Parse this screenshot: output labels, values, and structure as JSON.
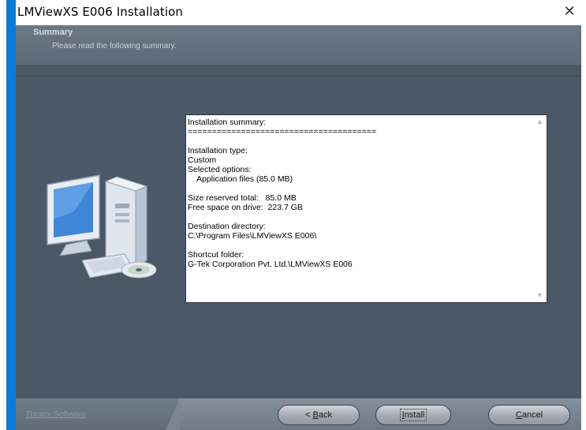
{
  "window": {
    "title": "LMViewXS E006 Installation",
    "close_glyph": "✕"
  },
  "header": {
    "heading": "Summary",
    "subheading": "Please read the following summary."
  },
  "summary": {
    "lines": [
      "Installation summary:",
      "=======================================",
      "",
      "Installation type:",
      "Custom",
      "Selected options:",
      "    Application files (85.0 MB)",
      "",
      "Size reserved total:   85.0 MB",
      "Free space on drive:  223.7 GB",
      "",
      "Destination directory:",
      "C:\\Program Files\\LMViewXS E006\\",
      "",
      "Shortcut folder:",
      "G-Tek Corporation Pvt. Ltd.\\LMViewXS E006"
    ]
  },
  "footer": {
    "brand": "Thraex Software",
    "back_pre": "< ",
    "back_mnemonic": "B",
    "back_post": "ack",
    "install_mnemonic": "I",
    "install_post": "nstall",
    "cancel_mnemonic": "C",
    "cancel_post": "ancel"
  },
  "colors": {
    "accent": "#0a7bd8",
    "client_bg": "#4b5866"
  }
}
